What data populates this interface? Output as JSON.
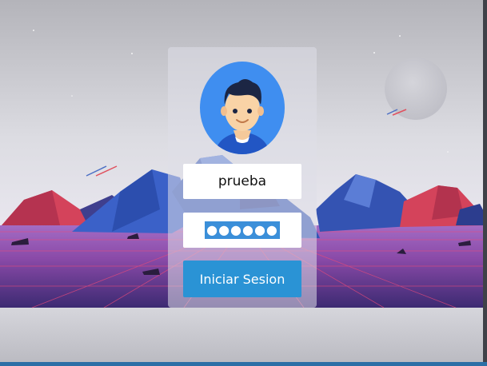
{
  "login": {
    "username_value": "prueba",
    "password_mask": "●●●●●●",
    "submit_label": "Iniciar Sesion"
  },
  "icons": {
    "avatar": "user-avatar-icon"
  },
  "colors": {
    "button": "#2a93d5",
    "avatar_bg": "#3f8ef0",
    "selection": "#3b8fd9"
  }
}
